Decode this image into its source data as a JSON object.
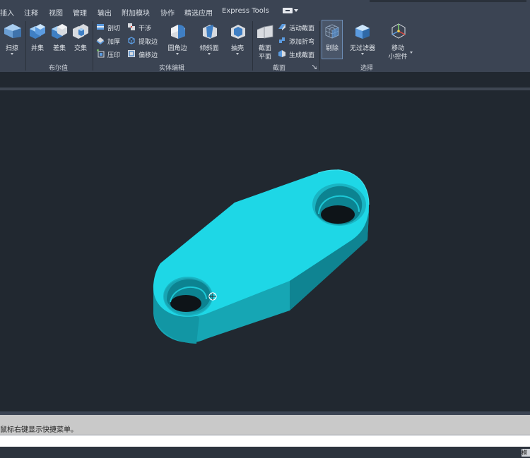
{
  "menu_tabs": [
    "插入",
    "注释",
    "视图",
    "管理",
    "输出",
    "附加模块",
    "协作",
    "精选应用",
    "Express Tools"
  ],
  "ribbon": {
    "create": {
      "sweep_label": "扫掠"
    },
    "boolean": {
      "title": "布尔值",
      "union_label": "并集",
      "subtract_label": "差集",
      "intersect_label": "交集"
    },
    "solid_edit": {
      "title": "实体编辑",
      "slice_label": "剖切",
      "thicken_label": "加厚",
      "imprint_label": "压印",
      "interfere_label": "干涉",
      "extract_edges_label": "提取边",
      "offset_edge_label": "偏移边",
      "fillet_edge_label": "圆角边",
      "taper_face_label": "倾斜面",
      "shell_label": "抽壳"
    },
    "section": {
      "title": "截面",
      "section_plane_line1": "截面",
      "section_plane_line2": "平面",
      "live_section_label": "活动截面",
      "add_jog_label": "添加折弯",
      "generate_section_label": "生成截面"
    },
    "selection": {
      "title": "选择",
      "culling_label": "剔除",
      "no_filter_label": "无过滤器",
      "move_gizmo_line1": "移动",
      "move_gizmo_line2": "小控件"
    }
  },
  "command_line": {
    "history_text": "鼠标右键显示快捷菜单。"
  },
  "status_bar": {
    "tag": "模"
  },
  "colors": {
    "model_top": "#1fd8e6",
    "model_side": "#15a3b2",
    "model_dark": "#0e7e8b",
    "viewport_bg": "#212830",
    "ribbon_bg": "#3b4453"
  }
}
